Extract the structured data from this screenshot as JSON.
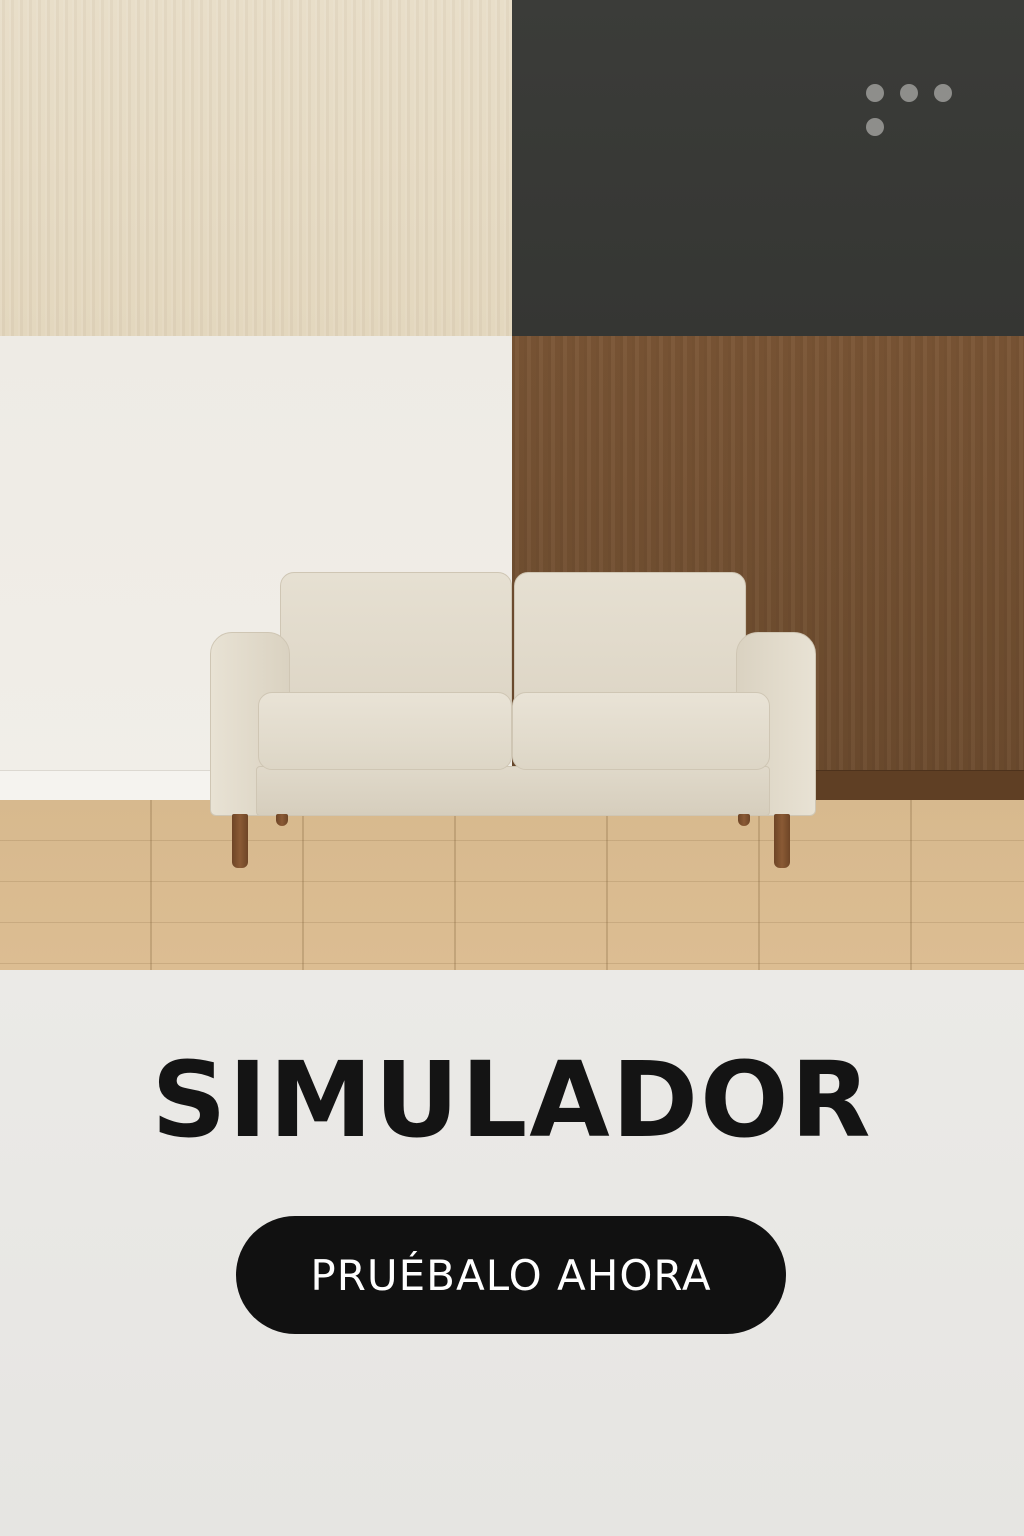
{
  "hero": {
    "title": "SIMULADOR",
    "cta_label": "PRUÉBALO AHORA"
  },
  "swatches": [
    {
      "name": "light-oak",
      "color": "#e4d8bf"
    },
    {
      "name": "charcoal",
      "color": "#383936"
    },
    {
      "name": "off-white",
      "color": "#efece6"
    },
    {
      "name": "walnut",
      "color": "#734f31"
    }
  ],
  "menu_icon": "more-dots-icon",
  "colors": {
    "cta_background": "#111111",
    "cta_text": "#ffffff",
    "title_text": "#141414",
    "lower_background": "#e9e8e5"
  }
}
